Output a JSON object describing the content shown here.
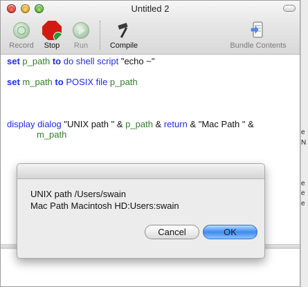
{
  "window": {
    "title": "Untitled 2"
  },
  "toolbar": {
    "record_label": "Record",
    "stop_label": "Stop",
    "run_label": "Run",
    "compile_label": "Compile",
    "bundle_label": "Bundle Contents"
  },
  "script": {
    "line1": {
      "kw1": "set",
      "var1": "p_path",
      "kw2": "to",
      "cmd": "do shell script",
      "str": "\"echo ~\""
    },
    "line2": {
      "kw1": "set",
      "var1": "m_path",
      "kw2": "to",
      "cmd": "POSIX file",
      "var2": "p_path"
    },
    "line3": {
      "cmd": "display dialog",
      "str1": "\"UNIX path \"",
      "amp1": "&",
      "var1": "p_path",
      "amp2": "&",
      "kw_return": "return",
      "amp3": "&",
      "str2": "\"Mac Path \"",
      "amp4": "&"
    },
    "line4": {
      "var": "m_path"
    }
  },
  "dialog": {
    "message_line1": "UNIX path /Users/swain",
    "message_line2": "Mac Path Macintosh HD:Users:swain",
    "cancel_label": "Cancel",
    "ok_label": "OK"
  },
  "edge_glyphs": {
    "e1": "e",
    "e2": "N",
    "e3": "e",
    "e4": "e",
    "e5": "e"
  },
  "colors": {
    "keyword": "#1d2de6",
    "variable": "#2f7d28",
    "ok_button": "#3e8bee",
    "stop_red": "#d11b12"
  },
  "icons": {
    "record": "record-icon",
    "stop": "stop-icon",
    "run": "run-icon",
    "compile": "hammer-icon",
    "bundle": "bundle-contents-icon"
  }
}
